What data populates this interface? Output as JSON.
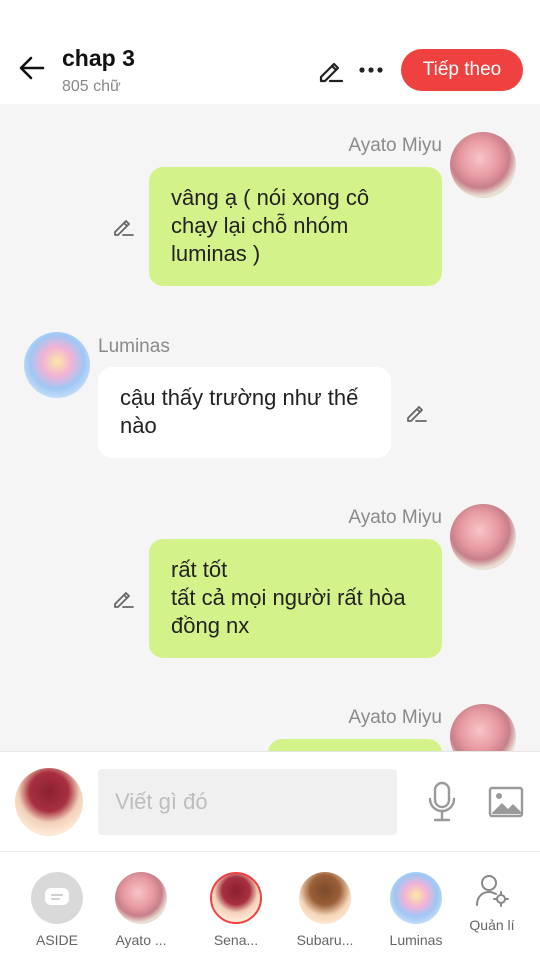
{
  "header": {
    "title": "chap 3",
    "subtitle": "805 chữ",
    "next_label": "Tiếp theo"
  },
  "messages": [
    {
      "speaker": "Ayato  Miyu",
      "text": "vâng ạ ( nói xong cô chạy lại chỗ nhóm luminas )",
      "side": "right"
    },
    {
      "speaker": "Luminas",
      "text": "cậu thấy trường như thế nào",
      "side": "left"
    },
    {
      "speaker": "Ayato  Miyu",
      "text": "rất tốt\ntất cả mọi người rất hòa đồng nx",
      "side": "right"
    },
    {
      "speaker": "Ayato  Miyu",
      "text": "",
      "side": "right"
    }
  ],
  "input": {
    "placeholder": "Viết gì đó"
  },
  "characters": [
    {
      "label": "ASIDE"
    },
    {
      "label": "Ayato ..."
    },
    {
      "label": "Sena..."
    },
    {
      "label": "Subaru..."
    },
    {
      "label": "Luminas"
    },
    {
      "label": "Quản lí"
    }
  ],
  "colors": {
    "accent": "#f04141",
    "bubble_green": "#d4f28a",
    "bubble_white": "#ffffff",
    "background": "#f5f5f5"
  }
}
